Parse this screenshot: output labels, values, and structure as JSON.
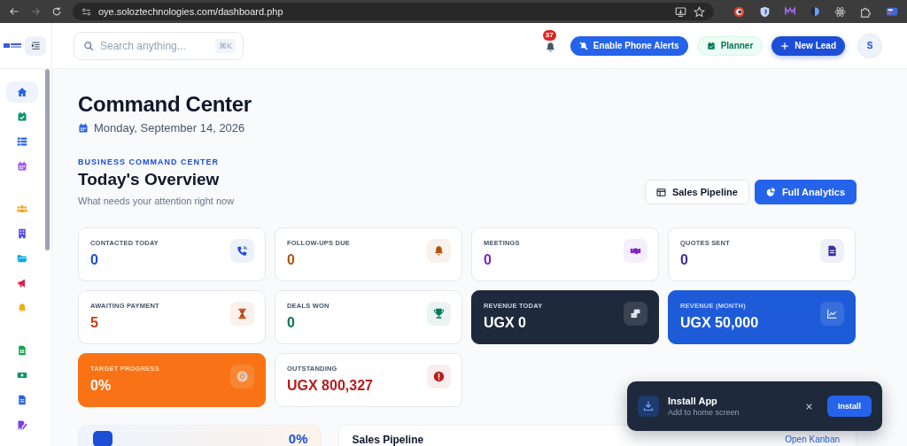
{
  "browser": {
    "url": "oye.soloztechnologies.com/dashboard.php"
  },
  "sidebar": {
    "items": [
      {
        "selected": true,
        "color": "#2563eb"
      },
      {
        "selected": false,
        "color": "#059669"
      },
      {
        "selected": false,
        "color": "#2563eb"
      },
      {
        "selected": false,
        "color": "#a855f7"
      },
      {
        "selected": false,
        "color": "#f59e0b"
      },
      {
        "selected": false,
        "color": "#4f46e5"
      },
      {
        "selected": false,
        "color": "#0ea5e9"
      },
      {
        "selected": false,
        "color": "#e11d48"
      },
      {
        "selected": false,
        "color": "#eab308"
      },
      {
        "selected": false,
        "color": "#16a34a"
      },
      {
        "selected": false,
        "color": "#059669"
      },
      {
        "selected": false,
        "color": "#2563eb"
      },
      {
        "selected": false,
        "color": "#7c3aed"
      }
    ]
  },
  "topbar": {
    "search": {
      "placeholder": "Search anything...",
      "shortcut": "⌘K"
    },
    "notifications": {
      "count": "37"
    },
    "buttons": [
      {
        "label": "Enable Phone Alerts",
        "kind": "primary"
      },
      {
        "label": "Planner",
        "kind": "soft"
      },
      {
        "label": "New Lead",
        "kind": "dark"
      }
    ],
    "avatar": "S"
  },
  "header": {
    "title": "Command Center",
    "date": "Monday, September 14, 2026"
  },
  "overview": {
    "eyebrow": "BUSINESS COMMAND CENTER",
    "title": "Today's Overview",
    "subtitle": "What needs your attention right now",
    "actions": [
      {
        "label": "Sales Pipeline",
        "kind": "outline"
      },
      {
        "label": "Full Analytics",
        "kind": "primary"
      }
    ]
  },
  "stats": [
    {
      "label": "CONTACTED TODAY",
      "value": "0",
      "kind": "light",
      "color": "#1d4ed8"
    },
    {
      "label": "FOLLOW-UPS DUE",
      "value": "0",
      "kind": "light",
      "color": "#b45309"
    },
    {
      "label": "MEETINGS",
      "value": "0",
      "kind": "light",
      "color": "#7e22ce"
    },
    {
      "label": "QUOTES SENT",
      "value": "0",
      "kind": "light",
      "color": "#3730a3"
    },
    {
      "label": "AWAITING PAYMENT",
      "value": "5",
      "kind": "light",
      "color": "#c2410c"
    },
    {
      "label": "DEALS WON",
      "value": "0",
      "kind": "light",
      "color": "#047857"
    },
    {
      "label": "REVENUE TODAY",
      "value": "UGX 0",
      "kind": "dark",
      "color": "#ffffff"
    },
    {
      "label": "REVENUE (MONTH)",
      "value": "UGX 50,000",
      "kind": "blue",
      "color": "#ffffff"
    },
    {
      "label": "TARGET PROGRESS",
      "value": "0%",
      "kind": "orange",
      "color": "#ffffff"
    },
    {
      "label": "OUTSTANDING",
      "value": "UGX 800,327",
      "kind": "light",
      "color": "#b91c1c"
    }
  ],
  "bottom": {
    "progress_card": {
      "value": "0%"
    },
    "pipeline_card": {
      "title": "Sales Pipeline",
      "link": "Open Kanban"
    }
  },
  "toast": {
    "title": "Install App",
    "subtitle": "Add to home screen",
    "button": "Install"
  }
}
